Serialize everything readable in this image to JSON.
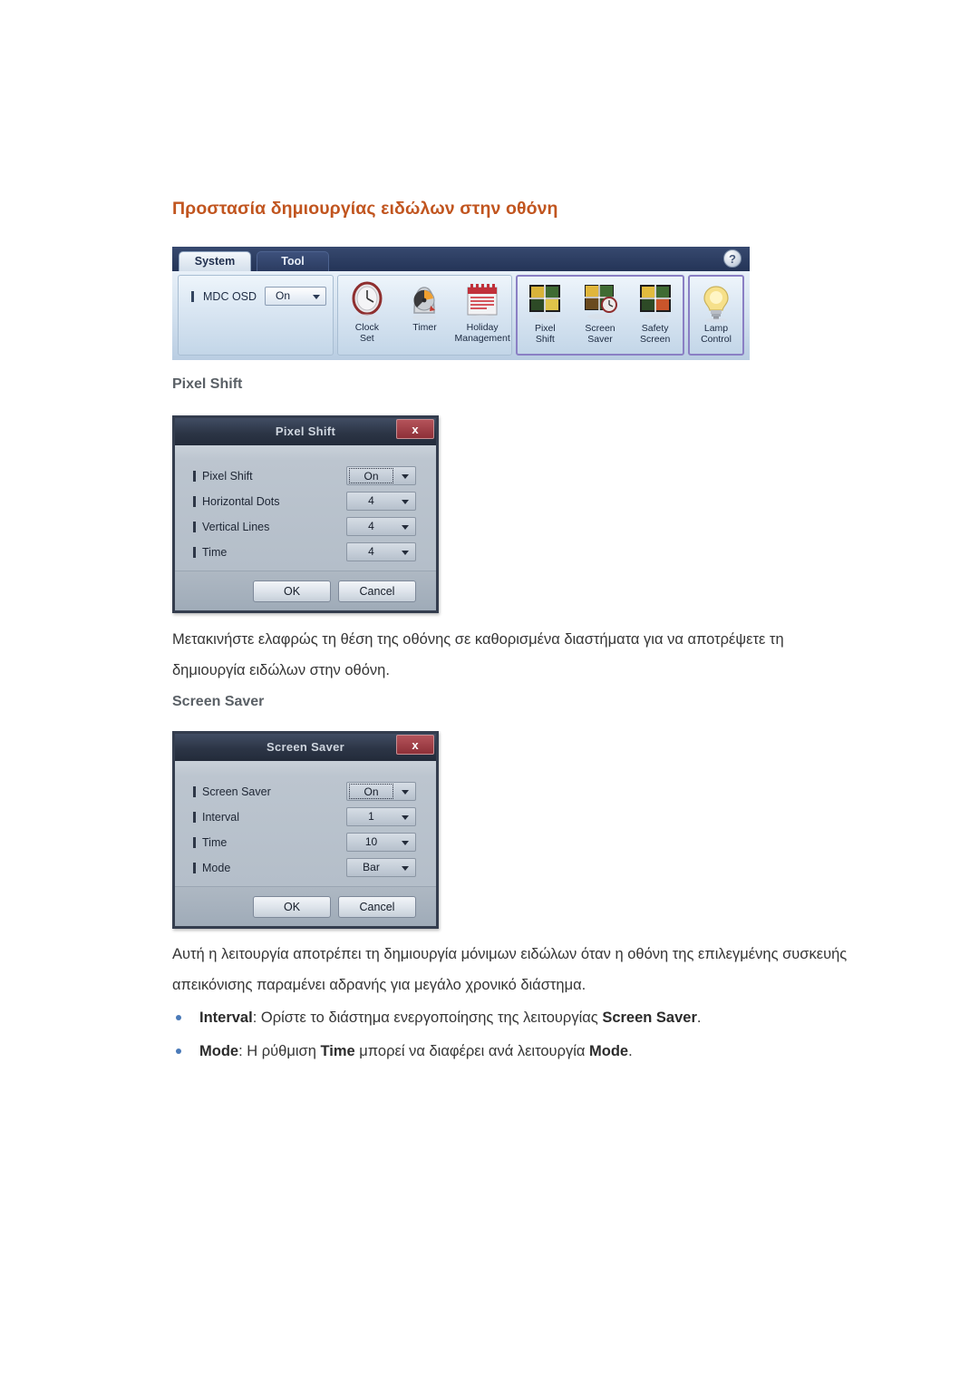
{
  "document": {
    "title": "Προστασία δημιουργίας ειδώλων στην οθόνη"
  },
  "toolbar": {
    "tabs": [
      {
        "label": "System",
        "active": true
      },
      {
        "label": "Tool",
        "active": false
      }
    ],
    "help_label": "?",
    "osd": {
      "label": "MDC OSD",
      "value": "On"
    },
    "groups": [
      {
        "name": "time-group",
        "icons": [
          {
            "name": "clock-set",
            "line1": "Clock",
            "line2": "Set"
          },
          {
            "name": "timer",
            "line1": "Timer",
            "line2": ""
          },
          {
            "name": "holiday-management",
            "line1": "Holiday",
            "line2": "Management"
          }
        ]
      },
      {
        "name": "screen-group",
        "highlighted": true,
        "icons": [
          {
            "name": "pixel-shift",
            "line1": "Pixel",
            "line2": "Shift"
          },
          {
            "name": "screen-saver",
            "line1": "Screen",
            "line2": "Saver"
          },
          {
            "name": "safety-screen",
            "line1": "Safety",
            "line2": "Screen"
          }
        ]
      },
      {
        "name": "lamp-group",
        "highlighted": true,
        "icons": [
          {
            "name": "lamp-control",
            "line1": "Lamp",
            "line2": "Control"
          }
        ]
      }
    ]
  },
  "sections": {
    "pixel_shift": {
      "heading": "Pixel Shift",
      "dialog": {
        "title": "Pixel Shift",
        "close_label": "x",
        "rows": [
          {
            "label": "Pixel Shift",
            "value": "On",
            "focused": true
          },
          {
            "label": "Horizontal Dots",
            "value": "4",
            "focused": false
          },
          {
            "label": "Vertical Lines",
            "value": "4",
            "focused": false
          },
          {
            "label": "Time",
            "value": "4",
            "focused": false
          }
        ],
        "ok_label": "OK",
        "cancel_label": "Cancel"
      },
      "paragraph": "Μετακινήστε ελαφρώς τη θέση της οθόνης σε καθορισμένα διαστήματα για να αποτρέψετε τη δημιουργία ειδώλων στην οθόνη."
    },
    "screen_saver": {
      "heading": "Screen Saver",
      "dialog": {
        "title": "Screen Saver",
        "close_label": "x",
        "rows": [
          {
            "label": "Screen Saver",
            "value": "On",
            "focused": true
          },
          {
            "label": "Interval",
            "value": "1",
            "focused": false
          },
          {
            "label": "Time",
            "value": "10",
            "focused": false
          },
          {
            "label": "Mode",
            "value": "Bar",
            "focused": false
          }
        ],
        "ok_label": "OK",
        "cancel_label": "Cancel"
      },
      "paragraph": "Αυτή η λειτουργία αποτρέπει τη δημιουργία μόνιμων ειδώλων όταν η οθόνη της επιλεγμένης συσκευής απεικόνισης παραμένει αδρανής για μεγάλο χρονικό διάστημα.",
      "bullets": [
        {
          "parts": [
            {
              "text": "Interval",
              "bold": true
            },
            {
              "text": ": Ορίστε το διάστημα ενεργοποίησης της λειτουργίας ",
              "bold": false
            },
            {
              "text": "Screen Saver",
              "bold": true
            },
            {
              "text": ".",
              "bold": false
            }
          ]
        },
        {
          "parts": [
            {
              "text": "Mode",
              "bold": true
            },
            {
              "text": ": Η ρύθμιση ",
              "bold": false
            },
            {
              "text": "Time",
              "bold": true
            },
            {
              "text": " μπορεί να διαφέρει ανά λειτουργία ",
              "bold": false
            },
            {
              "text": "Mode",
              "bold": true
            },
            {
              "text": ".",
              "bold": false
            }
          ]
        }
      ]
    }
  },
  "colors": {
    "title_orange": "#c1551f",
    "heading_gray": "#5a6066",
    "bullet_blue": "#4a7ab8",
    "dialog_close_red": "#8e3038",
    "highlight_purple": "#8a7fc4"
  }
}
